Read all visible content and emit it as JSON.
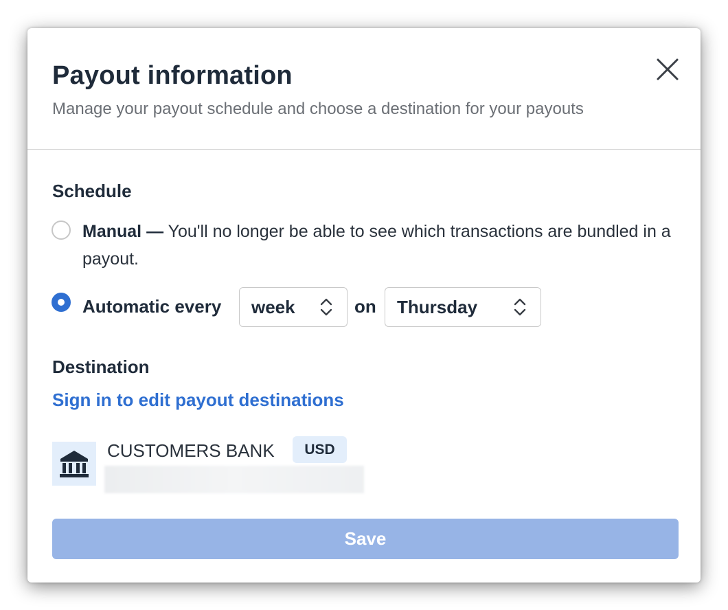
{
  "dialog": {
    "title": "Payout information",
    "subtitle": "Manage your payout schedule and choose a destination for your payouts",
    "close_icon": "close-icon"
  },
  "schedule": {
    "heading": "Schedule",
    "manual": {
      "label": "Manual —",
      "description": "You'll no longer be able to see which transactions are bundled in a payout.",
      "selected": false
    },
    "automatic": {
      "label": "Automatic every",
      "selected": true,
      "frequency_value": "week",
      "on_label": "on",
      "day_value": "Thursday"
    }
  },
  "destination": {
    "heading": "Destination",
    "edit_link": "Sign in to edit payout destinations",
    "bank": {
      "icon": "bank-icon",
      "name": "CUSTOMERS BANK",
      "currency": "USD"
    }
  },
  "actions": {
    "save_label": "Save"
  },
  "colors": {
    "accent": "#2f6fd1",
    "save_disabled": "#97b4e6",
    "badge_bg": "#e3eefb",
    "heading_text": "#1f2b3a"
  }
}
